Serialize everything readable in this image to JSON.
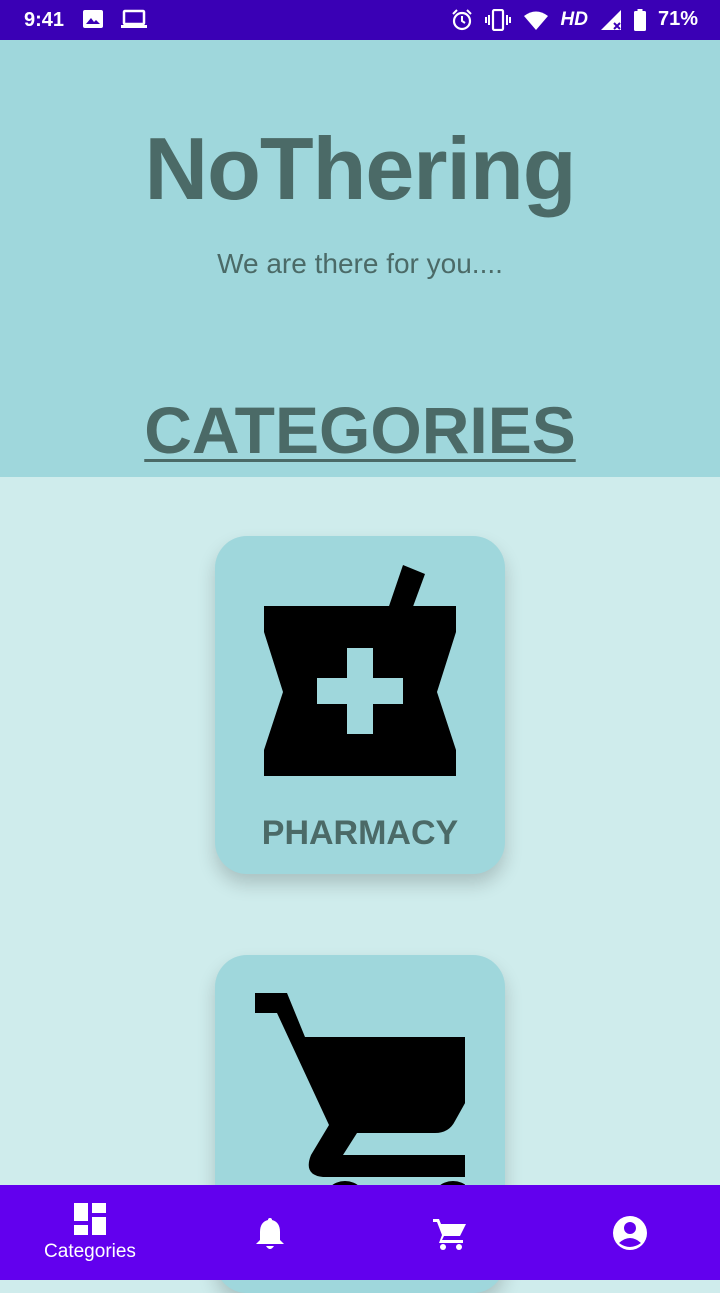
{
  "status_bar": {
    "time": "9:41",
    "network_label": "HD",
    "battery_percent": "71%",
    "icons": [
      "image-icon",
      "laptop-icon",
      "alarm-icon",
      "vibrate-icon",
      "wifi-icon",
      "signal-icon",
      "battery-icon"
    ]
  },
  "header": {
    "app_title": "NoThering",
    "tagline": "We are there for you....",
    "section_title": "CATEGORIES"
  },
  "categories": [
    {
      "label": "PHARMACY",
      "icon": "pharmacy-icon"
    },
    {
      "label": "",
      "icon": "shopping-cart-icon"
    }
  ],
  "bottom_nav": {
    "items": [
      {
        "label": "Categories",
        "icon": "dashboard-icon"
      },
      {
        "label": "",
        "icon": "bell-icon"
      },
      {
        "label": "",
        "icon": "cart-icon"
      },
      {
        "label": "",
        "icon": "account-icon"
      }
    ]
  },
  "colors": {
    "status_bar": "#3a00b5",
    "header_bg": "#9fd7dc",
    "body_bg": "#cfecec",
    "text": "#4b6a67",
    "bottom_nav": "#6200ee"
  }
}
